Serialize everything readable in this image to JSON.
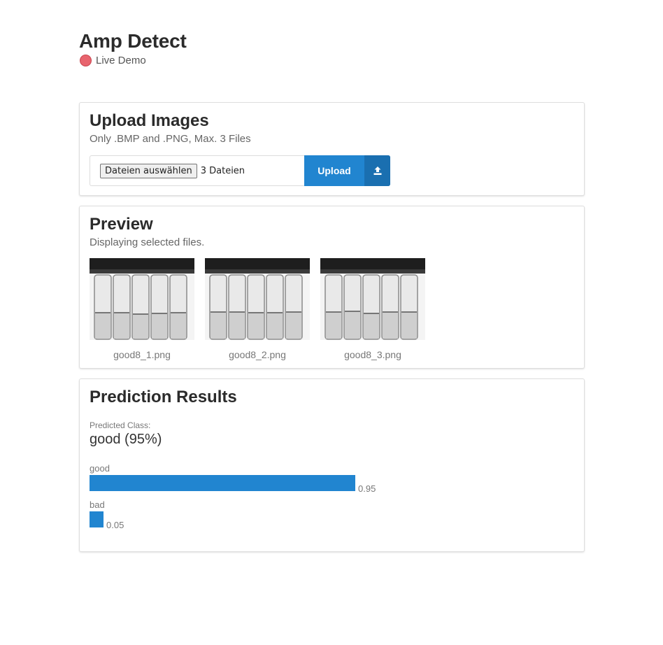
{
  "header": {
    "title": "Amp Detect",
    "status": "Live Demo",
    "status_color": "#e8646e"
  },
  "upload": {
    "title": "Upload Images",
    "subtitle": "Only .BMP and .PNG, Max. 3 Files",
    "choose_label": "Dateien auswählen",
    "file_count": "3 Dateien",
    "button_label": "Upload",
    "button_icon": "upload-icon",
    "accent": "#2185d0"
  },
  "preview": {
    "title": "Preview",
    "subtitle": "Displaying selected files.",
    "files": [
      {
        "name": "good8_1.png"
      },
      {
        "name": "good8_2.png"
      },
      {
        "name": "good8_3.png"
      }
    ]
  },
  "results": {
    "title": "Prediction Results",
    "predicted_label": "Predicted Class:",
    "predicted_value": "good (95%)",
    "bars": [
      {
        "label": "good",
        "value": 0.95,
        "value_text": "0.95"
      },
      {
        "label": "bad",
        "value": 0.05,
        "value_text": "0.05"
      }
    ]
  }
}
